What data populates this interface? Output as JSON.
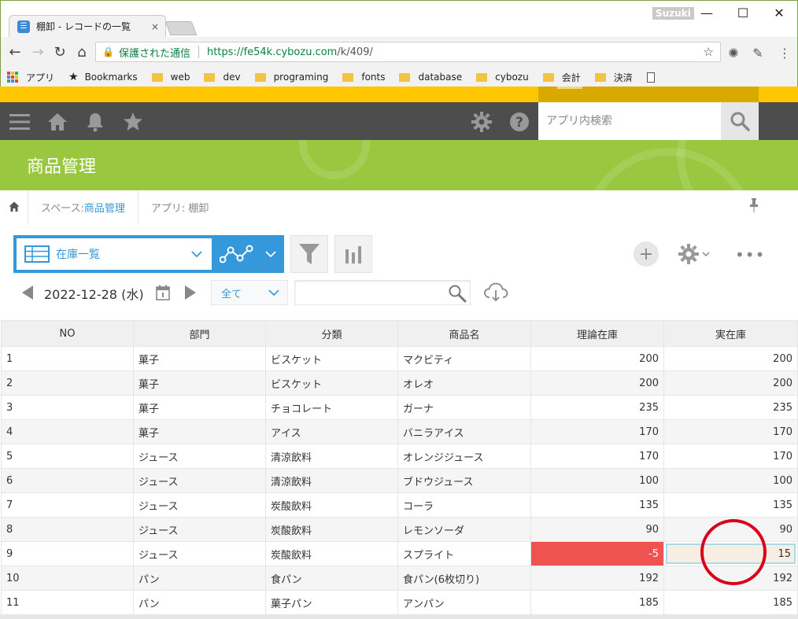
{
  "browser": {
    "tab_title": "棚卸 - レコードの一覧",
    "tab_close": "×",
    "user": "Suzuki",
    "secure_label": "保護された通信",
    "url_host": "https://fe54k.cybozu.com",
    "url_path": "/k/409/",
    "bookmarks": [
      "アプリ",
      "Bookmarks",
      "web",
      "dev",
      "programing",
      "fonts",
      "database",
      "cybozu",
      "会計",
      "決済"
    ]
  },
  "header": {
    "search_placeholder": "アプリ内検索"
  },
  "app": {
    "title": "商品管理"
  },
  "breadcrumb": {
    "space_prefix": "スペース: ",
    "space_name": "商品管理",
    "app_label": "アプリ: 棚卸"
  },
  "view": {
    "name": "在庫一覧",
    "date": "2022-12-28 (水)",
    "filter": "全て",
    "keyword": ""
  },
  "table": {
    "headers": [
      "NO",
      "部門",
      "分類",
      "商品名",
      "理論在庫",
      "実在庫"
    ],
    "rows": [
      [
        "1",
        "菓子",
        "ビスケット",
        "マクビティ",
        "200",
        "200"
      ],
      [
        "2",
        "菓子",
        "ビスケット",
        "オレオ",
        "200",
        "200"
      ],
      [
        "3",
        "菓子",
        "チョコレート",
        "ガーナ",
        "235",
        "235"
      ],
      [
        "4",
        "菓子",
        "アイス",
        "バニラアイス",
        "170",
        "170"
      ],
      [
        "5",
        "ジュース",
        "清涼飲料",
        "オレンジジュース",
        "170",
        "170"
      ],
      [
        "6",
        "ジュース",
        "清涼飲料",
        "ブドウジュース",
        "100",
        "100"
      ],
      [
        "7",
        "ジュース",
        "炭酸飲料",
        "コーラ",
        "135",
        "135"
      ],
      [
        "8",
        "ジュース",
        "炭酸飲料",
        "レモンソーダ",
        "90",
        "90"
      ],
      [
        "9",
        "ジュース",
        "炭酸飲料",
        "スプライト",
        "-5",
        "15"
      ],
      [
        "10",
        "パン",
        "食パン",
        "食パン(6枚切り)",
        "192",
        "192"
      ],
      [
        "11",
        "パン",
        "菓子パン",
        "アンパン",
        "185",
        "185"
      ]
    ]
  },
  "colors": {
    "brand_green": "#99c840",
    "accent_blue": "#3498db",
    "alert_red": "#f05252",
    "header_yellow": "#fdc600"
  }
}
